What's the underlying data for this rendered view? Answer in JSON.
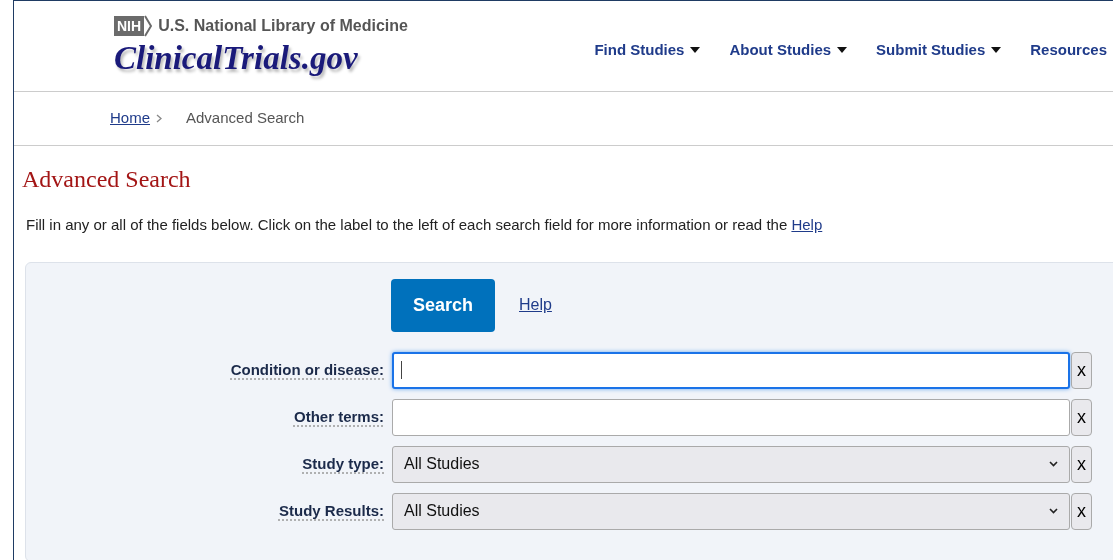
{
  "header": {
    "agency": "NIH",
    "library": "U.S. National Library of Medicine",
    "site_title": "ClinicalTrials.gov"
  },
  "nav": [
    {
      "label": "Find Studies"
    },
    {
      "label": "About Studies"
    },
    {
      "label": "Submit Studies"
    },
    {
      "label": "Resources"
    }
  ],
  "breadcrumb": [
    {
      "label": "Home",
      "link": true
    },
    {
      "label": "Advanced Search",
      "link": false
    }
  ],
  "page_title": "Advanced Search",
  "intro": {
    "text": "Fill in any or all of the fields below. Click on the label to the left of each search field for more information or read the",
    "link": "Help"
  },
  "form": {
    "search_button": "Search",
    "help_link": "Help",
    "fields": [
      {
        "kind": "text",
        "label": "Condition or disease:",
        "focused": true,
        "clear": "x"
      },
      {
        "kind": "text",
        "label": "Other terms:",
        "focused": false,
        "clear": "x"
      },
      {
        "kind": "select",
        "label": "Study type:",
        "value": "All Studies",
        "clear": "x"
      },
      {
        "kind": "select",
        "label": "Study Results:",
        "value": "All Studies",
        "clear": "x"
      }
    ]
  }
}
